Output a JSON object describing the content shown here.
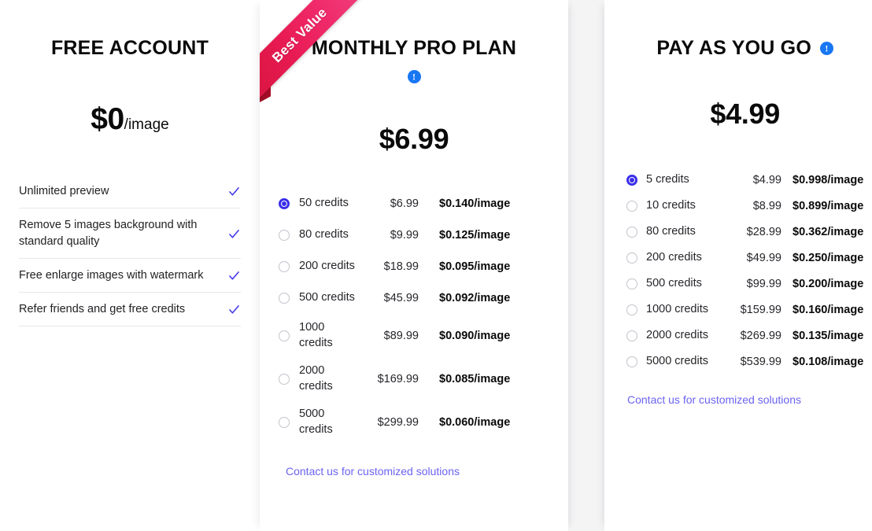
{
  "colors": {
    "accent_indigo": "#3b2ee8",
    "link_indigo": "#6b63f0",
    "info_blue": "#1877f2",
    "ribbon_pink": "#ee2060",
    "ribbon_crimson": "#d81540",
    "gutter_gray": "#f4f4f5"
  },
  "free_plan": {
    "title": "FREE ACCOUNT",
    "price_amount": "$0",
    "price_per": "/image",
    "features": [
      {
        "text": "Unlimited preview",
        "icon": "check-icon",
        "included": true
      },
      {
        "text": "Remove 5 images background with standard quality",
        "icon": "check-icon",
        "included": true
      },
      {
        "text": "Free enlarge images with watermark",
        "icon": "check-icon",
        "included": true
      },
      {
        "text": "Refer friends and get free credits",
        "icon": "check-icon",
        "included": true
      }
    ]
  },
  "pro_plan": {
    "ribbon": "Best Value",
    "title": "MONTHLY PRO PLAN",
    "info_icon": "info-icon",
    "info_glyph": "!",
    "price": "$6.99",
    "contact_link": "Contact us for customized solutions",
    "options": [
      {
        "credits": "50 credits",
        "price": "$6.99",
        "unit": "$0.140/image",
        "selected": true
      },
      {
        "credits": "80 credits",
        "price": "$9.99",
        "unit": "$0.125/image",
        "selected": false
      },
      {
        "credits": "200 credits",
        "price": "$18.99",
        "unit": "$0.095/image",
        "selected": false
      },
      {
        "credits": "500 credits",
        "price": "$45.99",
        "unit": "$0.092/image",
        "selected": false
      },
      {
        "credits": "1000 credits",
        "price": "$89.99",
        "unit": "$0.090/image",
        "selected": false
      },
      {
        "credits": "2000 credits",
        "price": "$169.99",
        "unit": "$0.085/image",
        "selected": false
      },
      {
        "credits": "5000 credits",
        "price": "$299.99",
        "unit": "$0.060/image",
        "selected": false
      }
    ]
  },
  "payg_plan": {
    "title": "PAY AS YOU GO",
    "info_icon": "info-icon",
    "info_glyph": "!",
    "price": "$4.99",
    "contact_link": "Contact us for customized solutions",
    "options": [
      {
        "credits": "5 credits",
        "price": "$4.99",
        "unit": "$0.998/image",
        "selected": true
      },
      {
        "credits": "10 credits",
        "price": "$8.99",
        "unit": "$0.899/image",
        "selected": false
      },
      {
        "credits": "80 credits",
        "price": "$28.99",
        "unit": "$0.362/image",
        "selected": false
      },
      {
        "credits": "200 credits",
        "price": "$49.99",
        "unit": "$0.250/image",
        "selected": false
      },
      {
        "credits": "500 credits",
        "price": "$99.99",
        "unit": "$0.200/image",
        "selected": false
      },
      {
        "credits": "1000 credits",
        "price": "$159.99",
        "unit": "$0.160/image",
        "selected": false
      },
      {
        "credits": "2000 credits",
        "price": "$269.99",
        "unit": "$0.135/image",
        "selected": false
      },
      {
        "credits": "5000 credits",
        "price": "$539.99",
        "unit": "$0.108/image",
        "selected": false
      }
    ]
  }
}
